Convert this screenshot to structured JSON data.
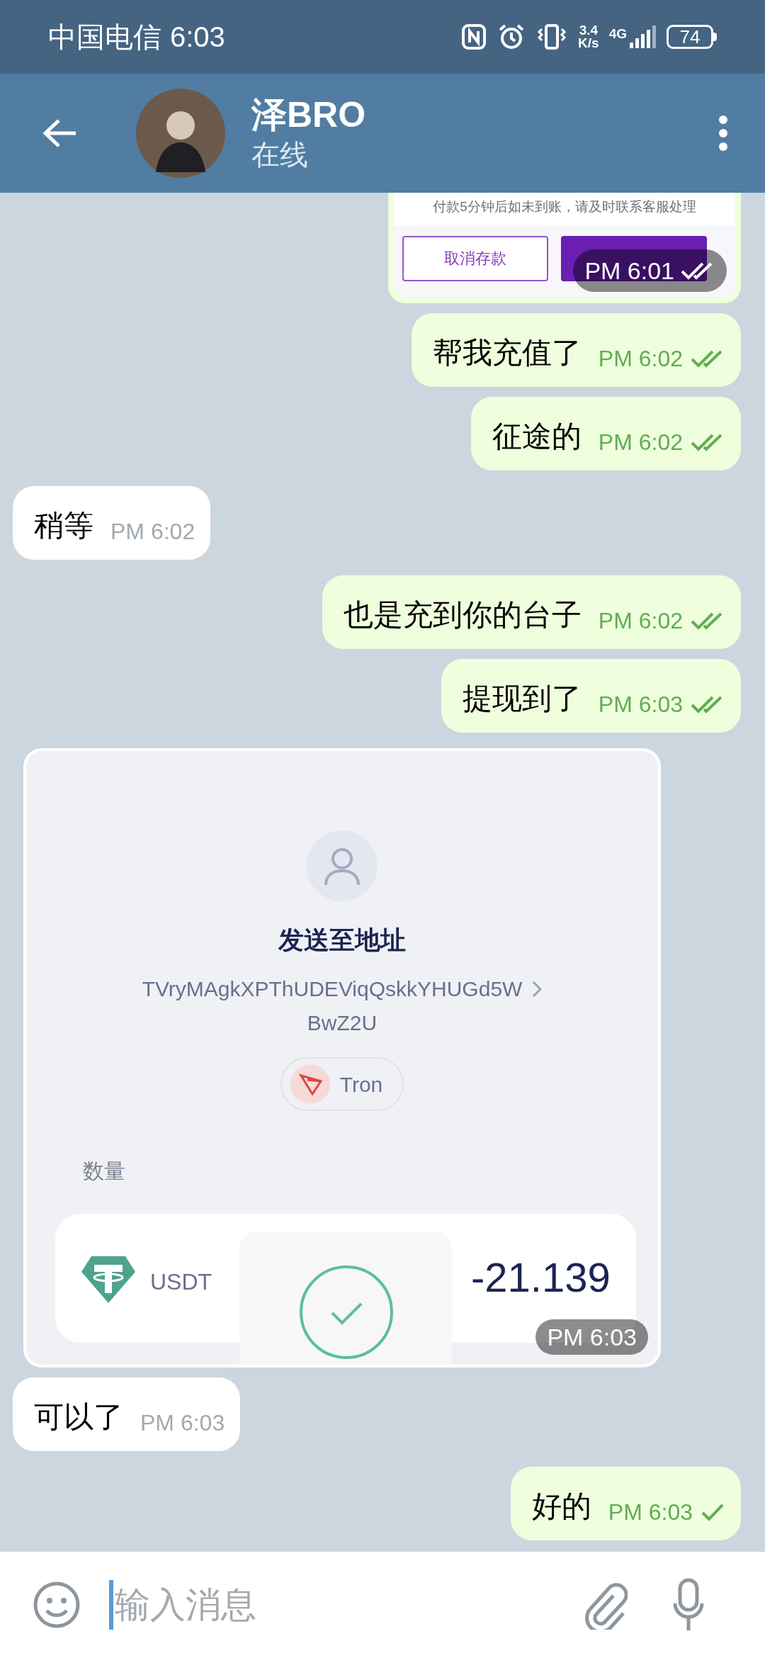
{
  "status_bar": {
    "carrier": "中国电信",
    "time": "6:03",
    "speed_value": "3.4",
    "speed_unit": "K/s",
    "network": "4G",
    "battery": "74"
  },
  "header": {
    "name": "泽BRO",
    "status": "在线"
  },
  "messages": [
    {
      "kind": "payment_screenshot",
      "outgoing": true,
      "notice": "付款5分钟后如未到账，请及时联系客服处理",
      "cancel_button": "取消存款",
      "time": "PM 6:01",
      "read": true
    },
    {
      "kind": "text",
      "outgoing": true,
      "text": "帮我充值了",
      "time": "PM 6:02",
      "read": true
    },
    {
      "kind": "text",
      "outgoing": true,
      "text": "征途的",
      "time": "PM 6:02",
      "read": true
    },
    {
      "kind": "text",
      "outgoing": false,
      "text": "稍等",
      "time": "PM 6:02"
    },
    {
      "kind": "text",
      "outgoing": true,
      "text": "也是充到你的台子",
      "time": "PM 6:02",
      "read": true
    },
    {
      "kind": "text",
      "outgoing": true,
      "text": "提现到了",
      "time": "PM 6:03",
      "read": true
    },
    {
      "kind": "transfer_screenshot",
      "outgoing": false,
      "heading": "发送至地址",
      "address_lines": [
        "TVryMAgkXPThUDEViqQskkYHUGd5W",
        "BwZ2U"
      ],
      "network": "Tron",
      "amount_label": "数量",
      "token": "USDT",
      "amount": "-21.139",
      "time": "PM 6:03"
    },
    {
      "kind": "text",
      "outgoing": false,
      "text": "可以了",
      "time": "PM 6:03"
    },
    {
      "kind": "text",
      "outgoing": true,
      "text": "好的",
      "time": "PM 6:03",
      "read": false
    }
  ],
  "composer": {
    "placeholder": "输入消息"
  }
}
